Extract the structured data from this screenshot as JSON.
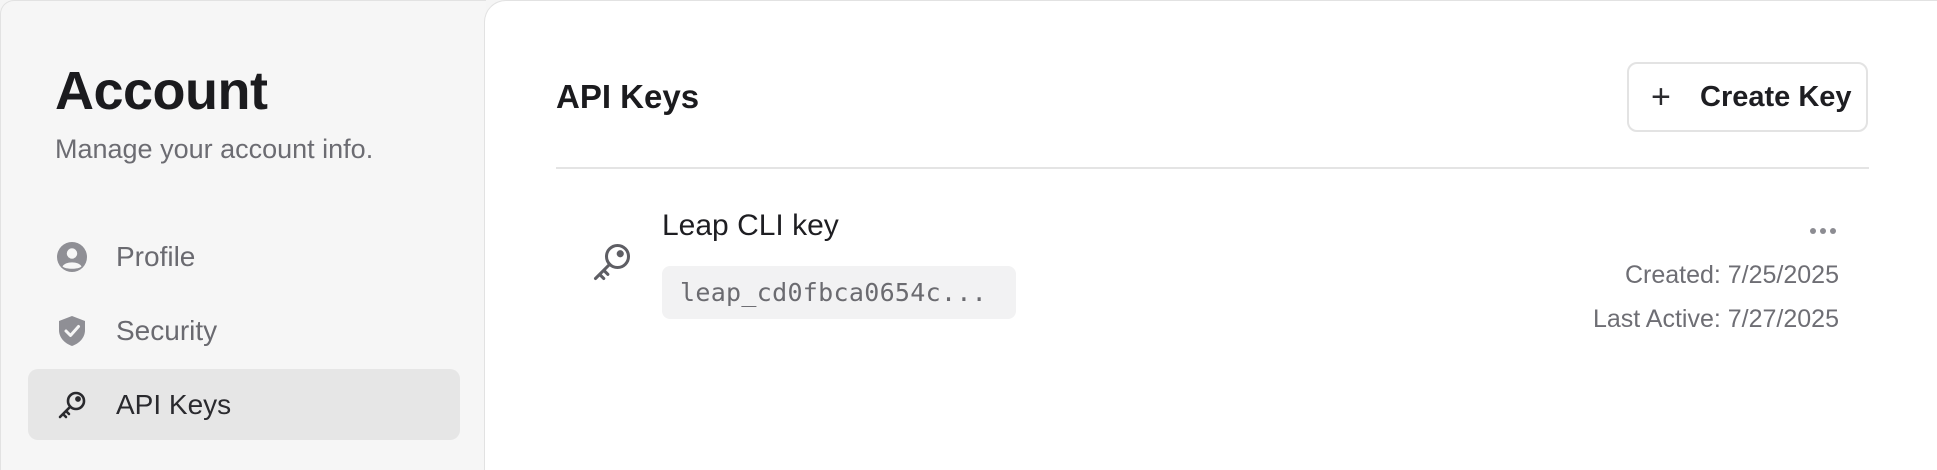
{
  "sidebar": {
    "title": "Account",
    "subtitle": "Manage your account info.",
    "items": [
      {
        "label": "Profile",
        "icon": "user-circle-icon",
        "active": false
      },
      {
        "label": "Security",
        "icon": "shield-check-icon",
        "active": false
      },
      {
        "label": "API Keys",
        "icon": "key-icon",
        "active": true
      }
    ]
  },
  "main": {
    "title": "API Keys",
    "create_button": {
      "icon": "plus-icon",
      "label": "Create Key"
    },
    "keys": [
      {
        "icon": "key-icon",
        "name": "Leap CLI key",
        "value": "leap_cd0fbca0654c...",
        "created": "Created: 7/25/2025",
        "last_active": "Last Active: 7/27/2025",
        "menu_icon": "more-horizontal-icon"
      }
    ]
  },
  "colors": {
    "sidebar_bg": "#f6f6f6",
    "active_item_bg": "#e6e6e6",
    "main_bg": "#ffffff",
    "muted_text": "#6c6c72",
    "code_bg": "#f2f2f3"
  }
}
